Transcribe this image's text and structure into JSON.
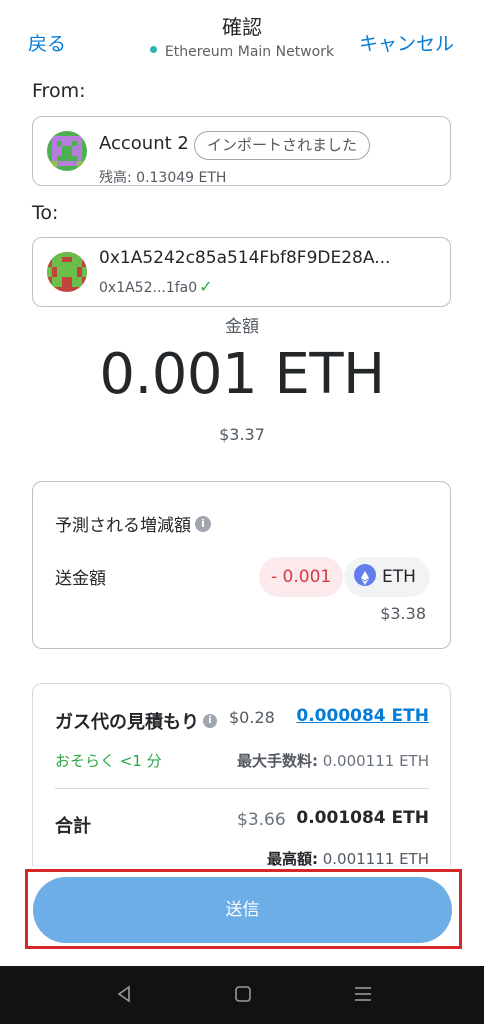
{
  "header": {
    "back_label": "戻る",
    "title": "確認",
    "network": "Ethereum Main Network",
    "cancel_label": "キャンセル"
  },
  "from": {
    "section_label": "From:",
    "account_name": "Account 2",
    "imported_tag": "インポートされました",
    "balance": "残高: 0.13049 ETH"
  },
  "to": {
    "section_label": "To:",
    "address": "0x1A5242c85a514Fbf8F9DE28A...",
    "short_address": "0x1A52...1fa0"
  },
  "amount": {
    "label": "金額",
    "value": "0.001 ETH",
    "fiat": "$3.37"
  },
  "simulation": {
    "title": "予測される増減額",
    "row_label": "送金額",
    "change": "- 0.001",
    "token": "ETH",
    "fiat": "$3.38"
  },
  "gas": {
    "title": "ガス代の見積もり",
    "fiat": "$0.28",
    "eth": "0.000084 ETH",
    "time": "おそらく <1 分",
    "max_fee_label": "最大手数料:",
    "max_fee_value": "0.000111 ETH"
  },
  "total": {
    "label": "合計",
    "fiat": "$3.66",
    "eth": "0.001084 ETH",
    "max_label": "最高額:",
    "max_value": "0.001111 ETH"
  },
  "actions": {
    "send_label": "送信"
  },
  "colors": {
    "accent": "#037dd6",
    "send_button": "#6caee5",
    "success": "#28a745",
    "negative": "#d73847",
    "highlight": "#d62828"
  },
  "icons": {
    "info": "info-icon",
    "check": "check-icon",
    "eth": "eth-icon",
    "network_dot": "network-status-dot-icon"
  }
}
